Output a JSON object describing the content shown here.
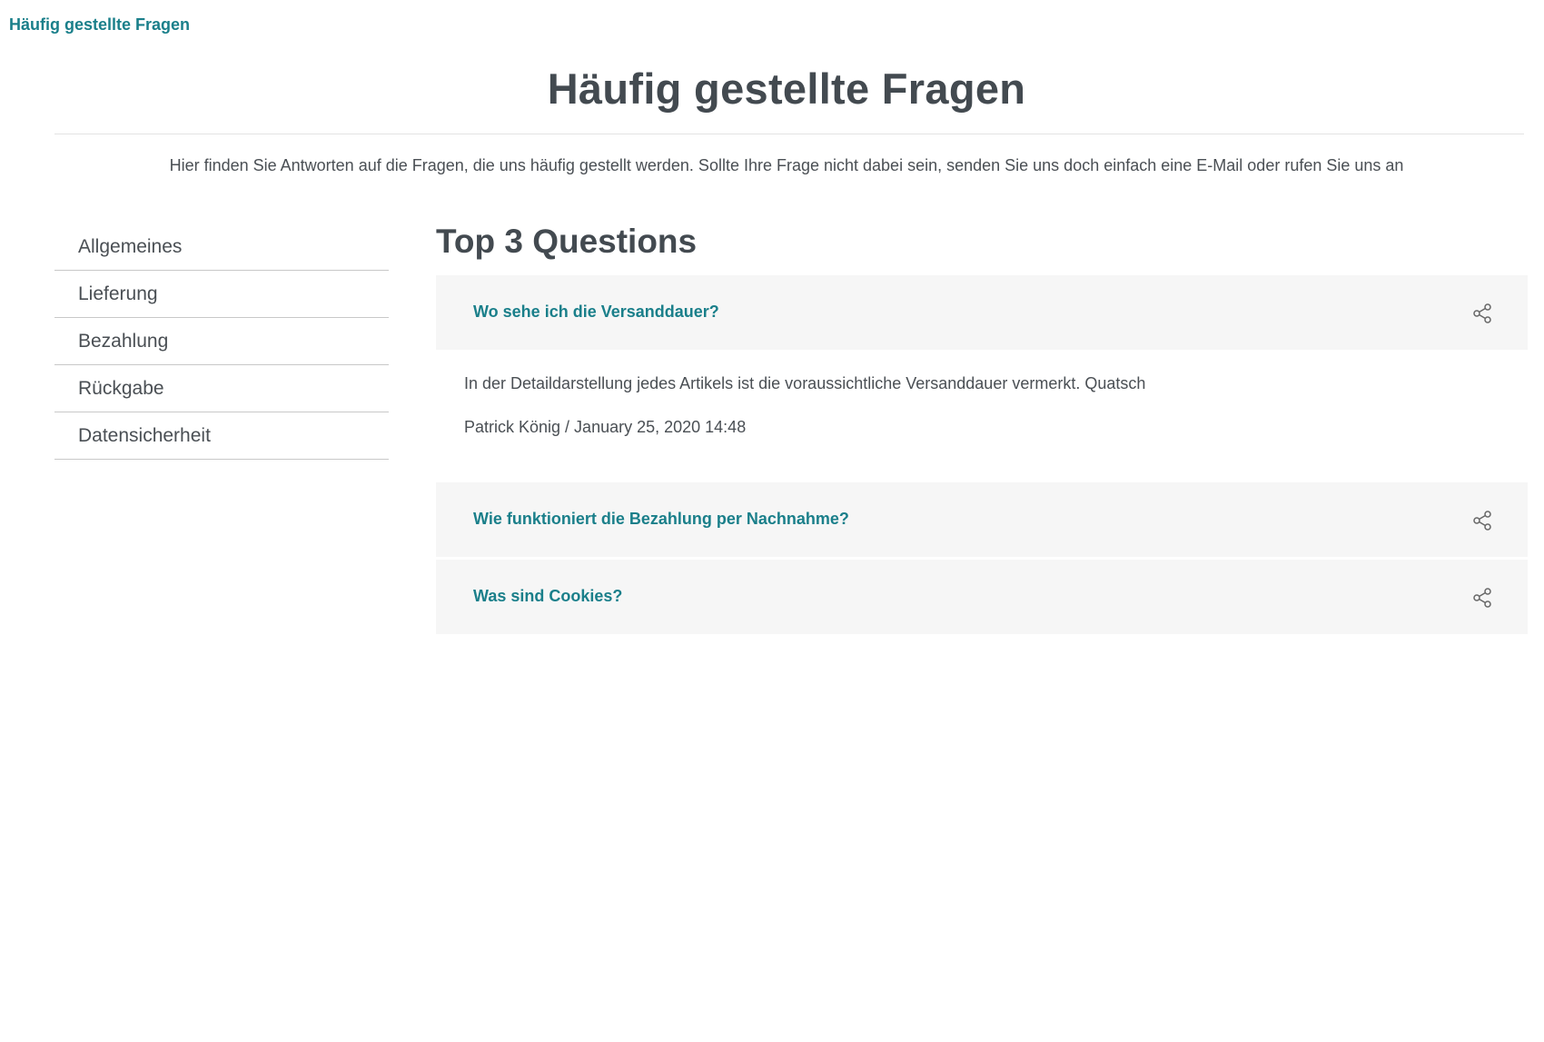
{
  "breadcrumb": {
    "label": "Häufig gestellte Fragen"
  },
  "page": {
    "title": "Häufig gestellte Fragen",
    "intro": "Hier finden Sie Antworten auf die Fragen, die uns häufig gestellt werden. Sollte Ihre Frage nicht dabei sein, senden Sie uns doch einfach eine E-Mail oder rufen Sie uns an"
  },
  "sidebar": {
    "items": [
      {
        "label": "Allgemeines"
      },
      {
        "label": "Lieferung"
      },
      {
        "label": "Bezahlung"
      },
      {
        "label": "Rückgabe"
      },
      {
        "label": "Datensicherheit"
      }
    ]
  },
  "main": {
    "section_title": "Top 3 Questions",
    "questions": [
      {
        "question": "Wo sehe ich die Versanddauer?",
        "expanded": true,
        "answer": "In der Detaildarstellung jedes Artikels ist die voraussichtliche Versanddauer vermerkt. Quatsch",
        "meta": "Patrick König / January 25, 2020 14:48",
        "share_icon": "share-icon"
      },
      {
        "question": "Wie funktioniert die Bezahlung per Nachnahme?",
        "expanded": false,
        "share_icon": "share-icon"
      },
      {
        "question": "Was sind Cookies?",
        "expanded": false,
        "share_icon": "share-icon"
      }
    ]
  },
  "colors": {
    "accent": "#1a7f8a",
    "heading": "#434a50",
    "text": "#4a4f54",
    "panel": "#f6f6f6",
    "divider": "#c8c8c8"
  }
}
